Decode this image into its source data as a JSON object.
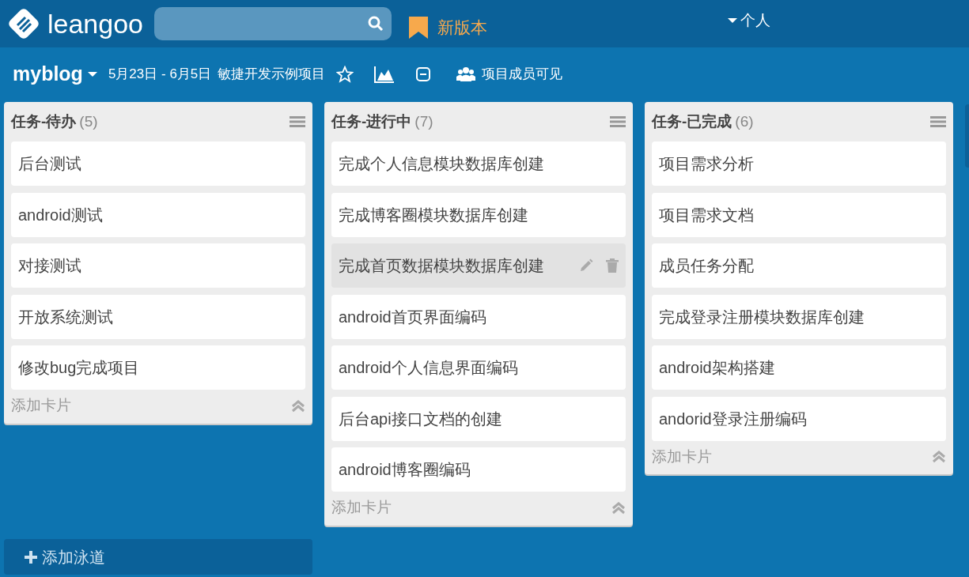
{
  "brand": {
    "name": "leangoo"
  },
  "new_version": {
    "label": "新版本"
  },
  "user_menu": {
    "label": "个人"
  },
  "board": {
    "name": "myblog",
    "dates": "5月23日 - 6月5日",
    "project": "敏捷开发示例项目",
    "visibility": "项目成员可见"
  },
  "lists": [
    {
      "title": "任务-待办",
      "count": "(5)",
      "add_label": "添加卡片",
      "cards": [
        {
          "text": "后台测试",
          "hovered": false
        },
        {
          "text": "android测试",
          "hovered": false
        },
        {
          "text": "对接测试",
          "hovered": false
        },
        {
          "text": "开放系统测试",
          "hovered": false
        },
        {
          "text": "修改bug完成项目",
          "hovered": false
        }
      ]
    },
    {
      "title": "任务-进行中",
      "count": "(7)",
      "add_label": "添加卡片",
      "cards": [
        {
          "text": "完成个人信息模块数据库创建",
          "hovered": false
        },
        {
          "text": "完成博客圈模块数据库创建",
          "hovered": false
        },
        {
          "text": "完成首页数据模块数据库创建",
          "hovered": true
        },
        {
          "text": "android首页界面编码",
          "hovered": false
        },
        {
          "text": "android个人信息界面编码",
          "hovered": false
        },
        {
          "text": "后台api接口文档的创建",
          "hovered": false
        },
        {
          "text": "android博客圈编码",
          "hovered": false
        }
      ]
    },
    {
      "title": "任务-已完成",
      "count": "(6)",
      "add_label": "添加卡片",
      "cards": [
        {
          "text": "项目需求分析",
          "hovered": false
        },
        {
          "text": "项目需求文档",
          "hovered": false
        },
        {
          "text": "成员任务分配",
          "hovered": false
        },
        {
          "text": "完成登录注册模块数据库创建",
          "hovered": false
        },
        {
          "text": "android架构搭建",
          "hovered": false
        },
        {
          "text": "andorid登录注册编码",
          "hovered": false
        }
      ]
    }
  ],
  "add_lane": {
    "label": "添加泳道"
  }
}
